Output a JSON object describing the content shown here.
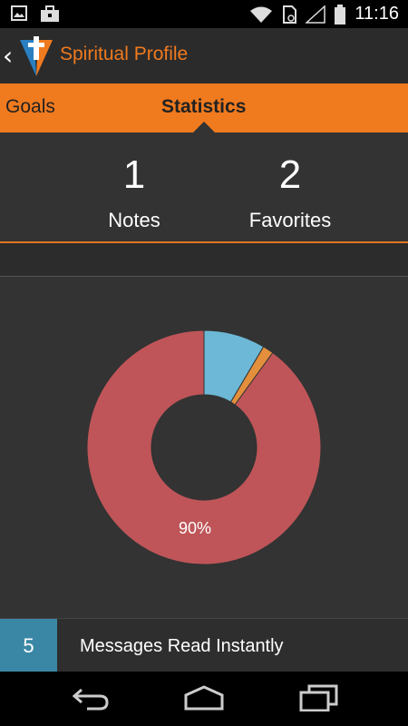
{
  "status_bar": {
    "time": "11:16",
    "icons": [
      "image-icon",
      "briefcase-icon",
      "wifi-icon",
      "sim-icon",
      "signal-icon",
      "battery-icon"
    ]
  },
  "action_bar": {
    "title": "Spiritual Profile",
    "back_icon": "chevron-left-icon",
    "logo_icon": "cross-logo-icon",
    "accent_color": "#f07a1e"
  },
  "tabs": [
    {
      "label": "Goals",
      "selected": false
    },
    {
      "label": "Statistics",
      "selected": true
    }
  ],
  "stats": {
    "notes": {
      "value": "1",
      "label": "Notes"
    },
    "favorites": {
      "value": "2",
      "label": "Favorites"
    }
  },
  "chart_data": {
    "type": "pie",
    "donut": true,
    "slices": [
      {
        "value": 90,
        "color": "#bf5558",
        "label": "90%"
      },
      {
        "value": 8.5,
        "color": "#6cb8d6",
        "label": ""
      },
      {
        "value": 1.5,
        "color": "#e38f3b",
        "label": ""
      }
    ]
  },
  "list": [
    {
      "count": "5",
      "label": "Messages Read Instantly"
    }
  ],
  "nav_bar": {
    "icons": [
      "back-icon",
      "home-icon",
      "recents-icon"
    ]
  }
}
